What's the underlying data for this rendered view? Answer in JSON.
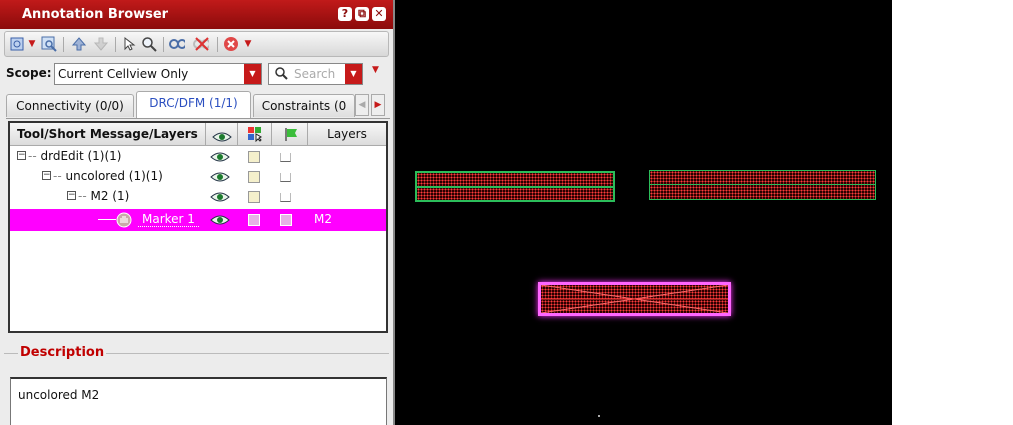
{
  "window": {
    "title": "Annotation Browser",
    "buttons": [
      "?",
      "⧉",
      "✕"
    ]
  },
  "toolbar": {
    "icons": [
      "select-cellview-icon",
      "dropdown-arrow-icon",
      "zoom-fit-icon",
      "up-level-icon",
      "down-level-icon",
      "pointer-icon",
      "zoom-icon",
      "link-icon",
      "unlink-icon",
      "delete-icon",
      "dropdown-arrow-icon"
    ]
  },
  "scope": {
    "label": "Scope:",
    "value": "Current Cellview Only",
    "search_placeholder": "Search"
  },
  "tabs": [
    {
      "label": "Connectivity (0/0)",
      "active": false
    },
    {
      "label": "DRC/DFM (1/1)",
      "active": true
    },
    {
      "label": "Constraints (0",
      "active": false
    }
  ],
  "tree": {
    "columns": [
      "Tool/Short Message/Layers",
      "",
      "",
      "",
      "Layers"
    ],
    "column_icons": [
      "visibility-eye-icon",
      "color-select-icon",
      "flag-icon"
    ],
    "rows": [
      {
        "label": "drdEdit (1)(1)",
        "level": 0,
        "expander": "−",
        "layers": ""
      },
      {
        "label": "uncolored (1)(1)",
        "level": 1,
        "expander": "−",
        "layers": ""
      },
      {
        "label": "M2 (1)",
        "level": 2,
        "expander": "−",
        "layers": ""
      },
      {
        "label": "Marker 1",
        "level": 3,
        "expander": "",
        "layers": "M2",
        "selected": true
      }
    ]
  },
  "description": {
    "title": "Description",
    "text": "uncolored M2"
  },
  "colors": {
    "accent_red": "#c11a1a",
    "selection": "#ff00ff",
    "canvas_bg": "#000000",
    "shape_green": "#2bbd5a",
    "marker_pink": "#ff66ff"
  }
}
